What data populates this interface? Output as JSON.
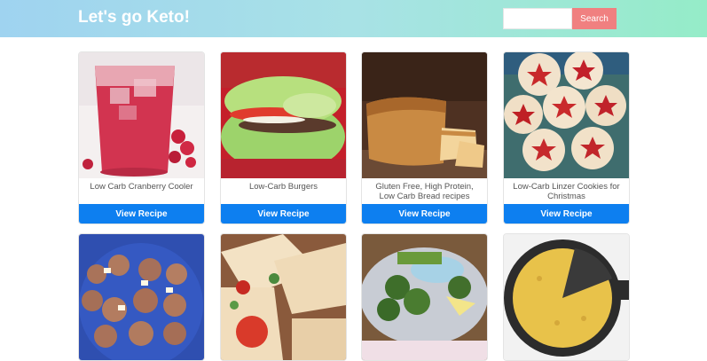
{
  "header": {
    "title": "Let's go Keto!",
    "search_placeholder": "",
    "search_label": "Search"
  },
  "colors": {
    "search_button": "#f08080",
    "view_button": "#0d7ff0"
  },
  "recipes": [
    {
      "title": "Low Carb Cranberry Cooler",
      "button": "View Recipe",
      "image": "cranberry-drink-image"
    },
    {
      "title": "Low-Carb Burgers",
      "button": "View Recipe",
      "image": "lettuce-burger-image"
    },
    {
      "title": "Gluten Free, High Protein, Low Carb Bread recipes",
      "button": "View Recipe",
      "image": "bread-loaf-image"
    },
    {
      "title": "Low-Carb Linzer Cookies for Christmas",
      "button": "View Recipe",
      "image": "linzer-cookies-image"
    },
    {
      "title": "",
      "button": "",
      "image": "pancakes-image"
    },
    {
      "title": "",
      "button": "",
      "image": "wraps-image"
    },
    {
      "title": "",
      "button": "",
      "image": "green-balls-image"
    },
    {
      "title": "",
      "button": "",
      "image": "skillet-cornbread-image"
    }
  ]
}
